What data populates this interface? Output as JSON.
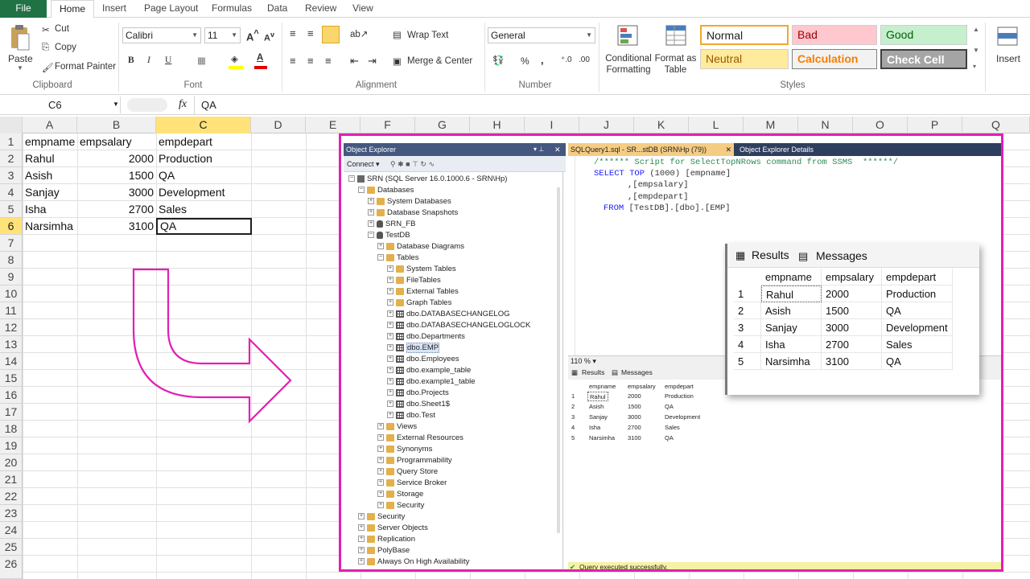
{
  "ribbon": {
    "tabs": [
      "File",
      "Home",
      "Insert",
      "Page Layout",
      "Formulas",
      "Data",
      "Review",
      "View"
    ],
    "clipboard": {
      "paste": "Paste",
      "cut": "Cut",
      "copy": "Copy",
      "format_painter": "Format Painter",
      "group": "Clipboard"
    },
    "font": {
      "name": "Calibri",
      "size": "11",
      "bold": "B",
      "italic": "I",
      "underline": "U",
      "group": "Font"
    },
    "alignment": {
      "wrap": "Wrap Text",
      "merge": "Merge & Center",
      "group": "Alignment"
    },
    "number": {
      "format": "General",
      "percent": "%",
      "comma": ",",
      "group": "Number"
    },
    "styles_group": {
      "conditional": "Conditional Formatting",
      "format_table": "Format as Table",
      "group": "Styles"
    },
    "styles": [
      {
        "label": "Normal",
        "bg": "#ffffff",
        "fg": "#000000",
        "border": "#f0a830"
      },
      {
        "label": "Bad",
        "bg": "#ffc7ce",
        "fg": "#9c0006"
      },
      {
        "label": "Good",
        "bg": "#c6efce",
        "fg": "#006100"
      },
      {
        "label": "Neutral",
        "bg": "#ffeb9c",
        "fg": "#9c5700"
      },
      {
        "label": "Calculation",
        "bg": "#f2f2f2",
        "fg": "#fa7d00"
      },
      {
        "label": "Check Cell",
        "bg": "#a5a5a5",
        "fg": "#ffffff"
      }
    ],
    "insert": "Insert"
  },
  "formula_bar": {
    "name_box": "C6",
    "fx": "fx",
    "value": "QA"
  },
  "columns": [
    "A",
    "B",
    "C",
    "D",
    "E",
    "F",
    "G",
    "H",
    "I",
    "J",
    "K",
    "L",
    "M",
    "N",
    "O",
    "P",
    "Q"
  ],
  "rows": [
    "1",
    "2",
    "3",
    "4",
    "5",
    "6",
    "7",
    "8",
    "9",
    "10",
    "11",
    "12",
    "13",
    "14",
    "15",
    "16",
    "17",
    "18",
    "19",
    "20",
    "21",
    "22",
    "23",
    "24",
    "25",
    "26"
  ],
  "sheet": {
    "headers": [
      "empname",
      "empsalary",
      "empdepart"
    ],
    "data": [
      [
        "Rahul",
        "2000",
        "Production"
      ],
      [
        "Asish",
        "1500",
        "QA"
      ],
      [
        "Sanjay",
        "3000",
        "Development"
      ],
      [
        "Isha",
        "2700",
        "Sales"
      ],
      [
        "Narsimha",
        "3100",
        "QA"
      ]
    ]
  },
  "ssms": {
    "explorer_title": "Object Explorer",
    "connect": "Connect",
    "tree": [
      {
        "label": "SRN (SQL Server 16.0.1000.6 - SRN\\Hp)",
        "indent": 0,
        "icon": "srv",
        "exp": "-"
      },
      {
        "label": "Databases",
        "indent": 1,
        "icon": "folder",
        "exp": "-"
      },
      {
        "label": "System Databases",
        "indent": 2,
        "icon": "folder",
        "exp": "+"
      },
      {
        "label": "Database Snapshots",
        "indent": 2,
        "icon": "folder",
        "exp": "+"
      },
      {
        "label": "SRN_FB",
        "indent": 2,
        "icon": "db",
        "exp": "+"
      },
      {
        "label": "TestDB",
        "indent": 2,
        "icon": "db",
        "exp": "-"
      },
      {
        "label": "Database Diagrams",
        "indent": 3,
        "icon": "folder",
        "exp": "+"
      },
      {
        "label": "Tables",
        "indent": 3,
        "icon": "folder",
        "exp": "-"
      },
      {
        "label": "System Tables",
        "indent": 4,
        "icon": "folder",
        "exp": "+"
      },
      {
        "label": "FileTables",
        "indent": 4,
        "icon": "folder",
        "exp": "+"
      },
      {
        "label": "External Tables",
        "indent": 4,
        "icon": "folder",
        "exp": "+"
      },
      {
        "label": "Graph Tables",
        "indent": 4,
        "icon": "folder",
        "exp": "+"
      },
      {
        "label": "dbo.DATABASECHANGELOG",
        "indent": 4,
        "icon": "tbl",
        "exp": "+"
      },
      {
        "label": "dbo.DATABASECHANGELOGLOCK",
        "indent": 4,
        "icon": "tbl",
        "exp": "+"
      },
      {
        "label": "dbo.Departments",
        "indent": 4,
        "icon": "tbl",
        "exp": "+"
      },
      {
        "label": "dbo.EMP",
        "indent": 4,
        "icon": "tbl",
        "exp": "+",
        "selected": true
      },
      {
        "label": "dbo.Employees",
        "indent": 4,
        "icon": "tbl",
        "exp": "+"
      },
      {
        "label": "dbo.example_table",
        "indent": 4,
        "icon": "tbl",
        "exp": "+"
      },
      {
        "label": "dbo.example1_table",
        "indent": 4,
        "icon": "tbl",
        "exp": "+"
      },
      {
        "label": "dbo.Projects",
        "indent": 4,
        "icon": "tbl",
        "exp": "+"
      },
      {
        "label": "dbo.Sheet1$",
        "indent": 4,
        "icon": "tbl",
        "exp": "+"
      },
      {
        "label": "dbo.Test",
        "indent": 4,
        "icon": "tbl",
        "exp": "+"
      },
      {
        "label": "Views",
        "indent": 3,
        "icon": "folder",
        "exp": "+"
      },
      {
        "label": "External Resources",
        "indent": 3,
        "icon": "folder",
        "exp": "+"
      },
      {
        "label": "Synonyms",
        "indent": 3,
        "icon": "folder",
        "exp": "+"
      },
      {
        "label": "Programmability",
        "indent": 3,
        "icon": "folder",
        "exp": "+"
      },
      {
        "label": "Query Store",
        "indent": 3,
        "icon": "folder",
        "exp": "+"
      },
      {
        "label": "Service Broker",
        "indent": 3,
        "icon": "folder",
        "exp": "+"
      },
      {
        "label": "Storage",
        "indent": 3,
        "icon": "folder",
        "exp": "+"
      },
      {
        "label": "Security",
        "indent": 3,
        "icon": "folder",
        "exp": "+"
      },
      {
        "label": "Security",
        "indent": 1,
        "icon": "folder",
        "exp": "+"
      },
      {
        "label": "Server Objects",
        "indent": 1,
        "icon": "folder",
        "exp": "+"
      },
      {
        "label": "Replication",
        "indent": 1,
        "icon": "folder",
        "exp": "+"
      },
      {
        "label": "PolyBase",
        "indent": 1,
        "icon": "folder",
        "exp": "+"
      },
      {
        "label": "Always On High Availability",
        "indent": 1,
        "icon": "folder",
        "exp": "+"
      }
    ],
    "query_tab": "SQLQuery1.sql - SR...stDB (SRN\\Hp (79))",
    "details_tab": "Object Explorer Details",
    "code_comment": "/****** Script for SelectTopNRows command from SSMS  ******/",
    "code_select": "SELECT",
    "code_top": "TOP",
    "code_line1_rest": " (1000) [empname]",
    "code_line2": ",[empsalary]",
    "code_line3": ",[empdepart]",
    "code_from": "FROM",
    "code_line4_rest": " [TestDB].[dbo].[EMP]",
    "zoom": "110 %",
    "results_tab": "Results",
    "messages_tab": "Messages",
    "status": "Query executed successfully."
  },
  "results": {
    "headers": [
      "empname",
      "empsalary",
      "empdepart"
    ],
    "row_numbers": [
      "1",
      "2",
      "3",
      "4",
      "5"
    ],
    "rows": [
      [
        "Rahul",
        "2000",
        "Production"
      ],
      [
        "Asish",
        "1500",
        "QA"
      ],
      [
        "Sanjay",
        "3000",
        "Development"
      ],
      [
        "Isha",
        "2700",
        "Sales"
      ],
      [
        "Narsimha",
        "3100",
        "QA"
      ]
    ]
  },
  "accent_colors": {
    "excel_green": "#207245",
    "arrow": "#e21fb5",
    "selected_header": "#ffe27a"
  }
}
